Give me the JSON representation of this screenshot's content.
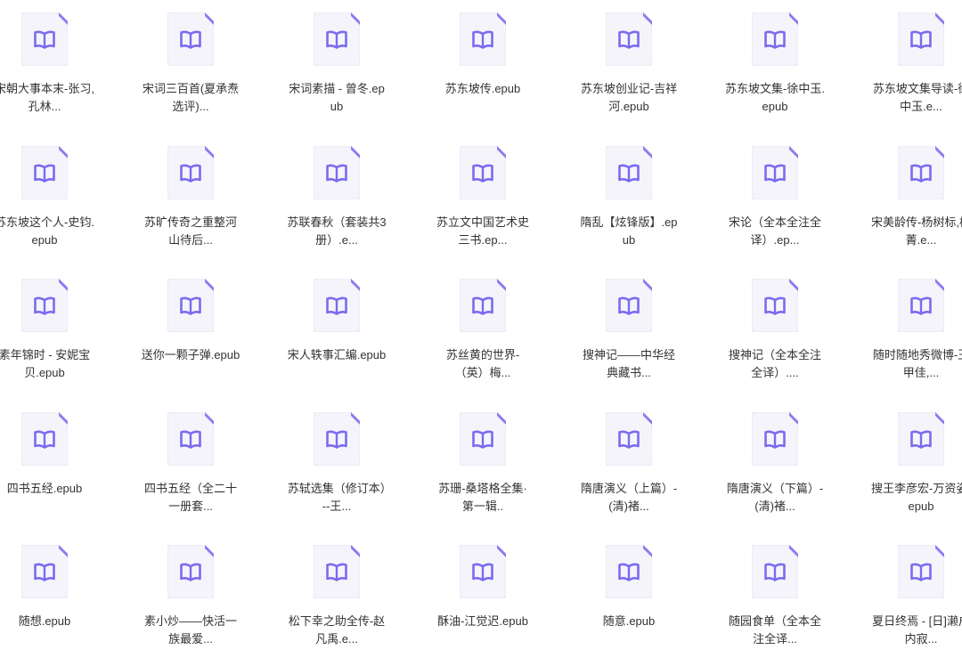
{
  "colors": {
    "icon_page": "#f5f4fb",
    "icon_border": "#e6e3f2",
    "icon_fold": "#8a7cf0",
    "icon_book": "#7b6bef",
    "text": "#333333"
  },
  "icon_name": "epub-book-file-icon",
  "files": [
    {
      "name": "宋朝大事本末-张习,孔林..."
    },
    {
      "name": "宋词三百首(夏承焘选评)..."
    },
    {
      "name": "宋词素描 - 曾冬.epub"
    },
    {
      "name": "苏东坡传.epub"
    },
    {
      "name": "苏东坡创业记-吉祥河.epub"
    },
    {
      "name": "苏东坡文集-徐中玉.epub"
    },
    {
      "name": "苏东坡文集导读-徐中玉.e..."
    },
    {
      "name": "苏东坡这个人-史钧.epub"
    },
    {
      "name": "苏旷传奇之重整河山待后..."
    },
    {
      "name": "苏联春秋（套装共3册）.e..."
    },
    {
      "name": "苏立文中国艺术史三书.ep..."
    },
    {
      "name": "隋乱【炫锋版】.epub"
    },
    {
      "name": "宋论（全本全注全译）.ep..."
    },
    {
      "name": "宋美龄传-杨树标,杨菁.e..."
    },
    {
      "name": "素年锦时 - 安妮宝贝.epub"
    },
    {
      "name": "送你一颗子弹.epub"
    },
    {
      "name": "宋人轶事汇编.epub"
    },
    {
      "name": "苏丝黄的世界-（英）梅..."
    },
    {
      "name": "搜神记——中华经典藏书..."
    },
    {
      "name": "搜神记（全本全注全译）...."
    },
    {
      "name": "随时随地秀微博-王甲佳,..."
    },
    {
      "name": "四书五经.epub"
    },
    {
      "name": "四书五经（全二十一册套..."
    },
    {
      "name": "苏轼选集（修订本）--王..."
    },
    {
      "name": "苏珊-桑塔格全集·第一辑.."
    },
    {
      "name": "隋唐演义（上篇）-(清)褚..."
    },
    {
      "name": "隋唐演义（下篇）-(清)褚..."
    },
    {
      "name": "搜王李彦宏-万资姿.epub"
    },
    {
      "name": "随想.epub"
    },
    {
      "name": "素小炒——快活一族最爱..."
    },
    {
      "name": "松下幸之助全传-赵凡禹.e..."
    },
    {
      "name": "酥油-江觉迟.epub"
    },
    {
      "name": "随意.epub"
    },
    {
      "name": "随园食单（全本全注全译..."
    },
    {
      "name": "夏日终焉 - [日]濑户内寂..."
    }
  ]
}
